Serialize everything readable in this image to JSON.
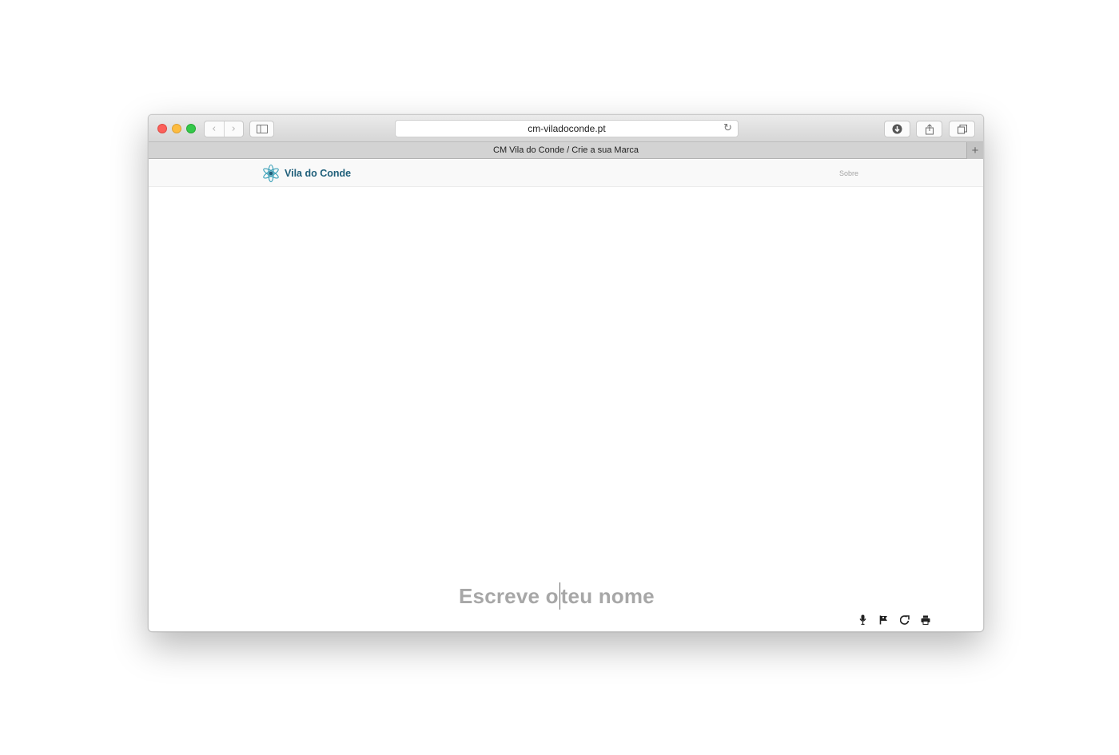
{
  "browser": {
    "url": "cm-viladoconde.pt",
    "tab_title": "CM Vila do Conde / Crie a sua Marca",
    "back_label": "‹",
    "forward_label": "›",
    "new_tab_label": "+"
  },
  "site": {
    "logo_text": "Vila do Conde",
    "nav_about": "Sobre",
    "brand_color": "#1f5f7a",
    "accent_color": "#3aa0b8"
  },
  "main": {
    "name_before_caret": "Escreve o",
    "name_after_caret": "teu nome"
  },
  "tools": [
    "microphone-icon",
    "flag-icon",
    "share-icon",
    "print-icon"
  ]
}
